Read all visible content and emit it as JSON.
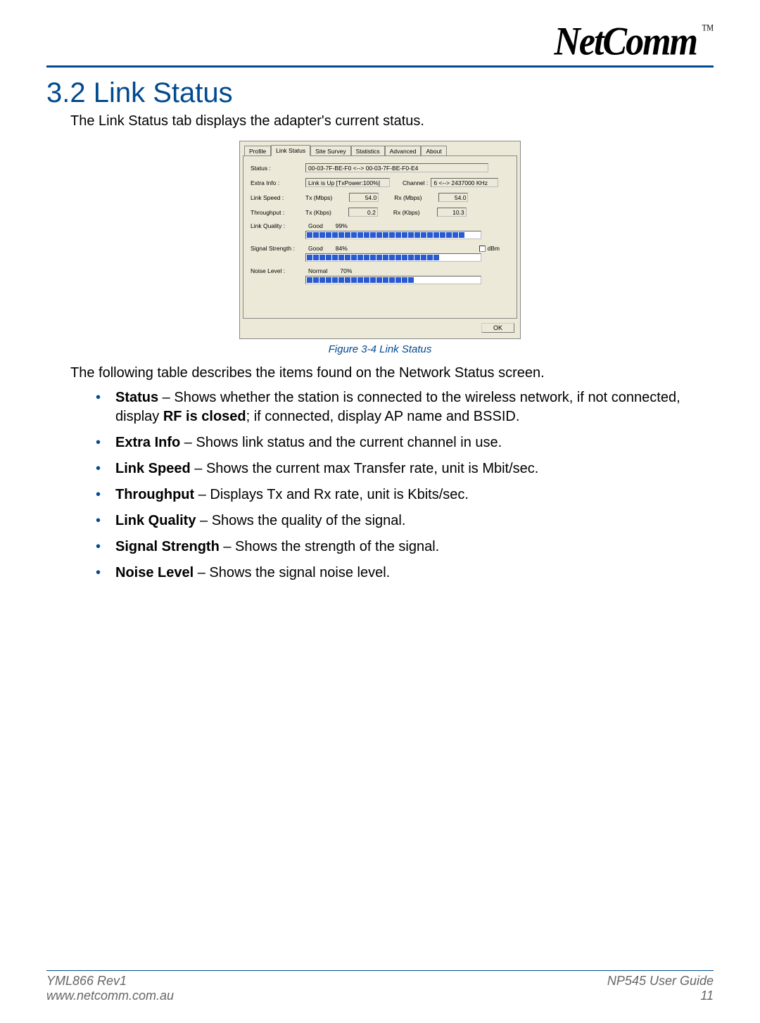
{
  "header": {
    "brand": "NetComm",
    "tm": "TM"
  },
  "section": {
    "title": "3.2 Link Status"
  },
  "intro_text": "The Link Status tab displays the adapter's current status.",
  "dialog": {
    "tabs": [
      "Profile",
      "Link Status",
      "Site Survey",
      "Statistics",
      "Advanced",
      "About"
    ],
    "active_tab_index": 1,
    "fields": {
      "status_label": "Status :",
      "status_value": "00-03-7F-BE-F0   <--> 00-03-7F-BE-F0-E4",
      "extra_info_label": "Extra Info :",
      "extra_info_value": "Link is Up [TxPower:100%]",
      "channel_label": "Channel :",
      "channel_value": "6 <--> 2437000 KHz",
      "link_speed_label": "Link Speed :",
      "tx_mbps_label": "Tx (Mbps)",
      "tx_mbps_value": "54.0",
      "rx_mbps_label": "Rx (Mbps)",
      "rx_mbps_value": "54.0",
      "throughput_label": "Throughput :",
      "tx_kbps_label": "Tx (Kbps)",
      "tx_kbps_value": "0.2",
      "rx_kbps_label": "Rx (Kbps)",
      "rx_kbps_value": "10.3",
      "link_quality_label": "Link Quality :",
      "link_quality_text": "Good",
      "link_quality_pct": "99%",
      "link_quality_segments": 25,
      "signal_strength_label": "Signal Strength :",
      "signal_strength_text": "Good",
      "signal_strength_pct": "84%",
      "signal_strength_segments": 21,
      "dbm_label": "dBm",
      "noise_level_label": "Noise Level :",
      "noise_level_text": "Normal",
      "noise_level_pct": "70%",
      "noise_level_segments": 17
    },
    "ok": "OK"
  },
  "figure_caption": "Figure 3-4 Link Status",
  "table_intro": "The following table describes the items found on the Network Status screen.",
  "items": [
    {
      "term": "Status",
      "between": " – Shows whether the station is connected to the wireless network, if not connected, display ",
      "emph": "RF is closed",
      "after": "; if connected, display AP name and BSSID."
    },
    {
      "term": "Extra Info",
      "text": " – Shows link status and the current channel in use."
    },
    {
      "term": "Link Speed",
      "text": " – Shows the current max Transfer rate, unit is Mbit/sec."
    },
    {
      "term": "Throughput",
      "text": " – Displays Tx and Rx rate, unit is Kbits/sec."
    },
    {
      "term": "Link Quality",
      "text": " – Shows the quality of the signal."
    },
    {
      "term": "Signal Strength",
      "text": " – Shows the strength of the signal."
    },
    {
      "term": "Noise Level",
      "text": " – Shows the signal noise level."
    }
  ],
  "footer": {
    "left_top": "YML866 Rev1",
    "left_bottom": "www.netcomm.com.au",
    "right_top": "NP545 User Guide",
    "right_bottom": "11"
  }
}
